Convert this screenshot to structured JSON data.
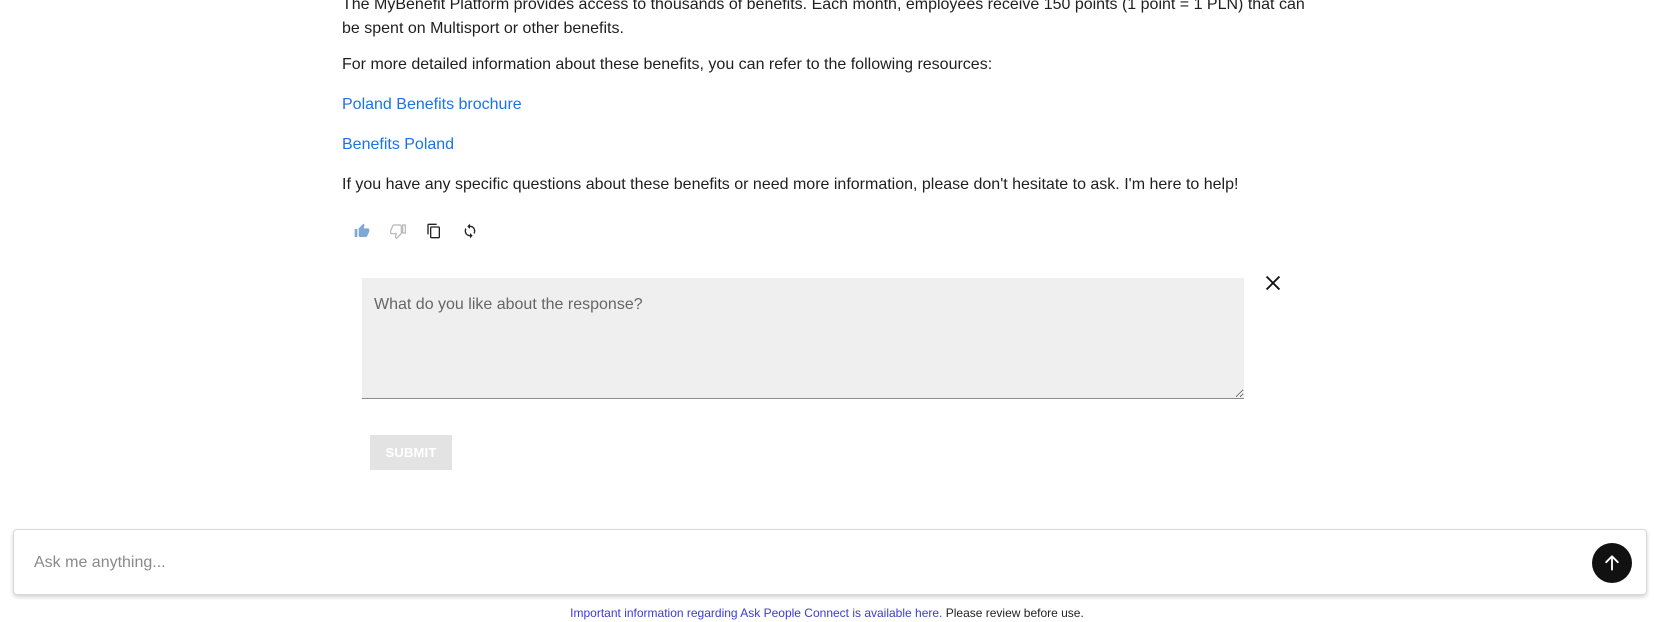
{
  "message": {
    "paragraph_1": "The MyBenefit Platform provides access to thousands of benefits. Each month, employees receive 150 points (1 point = 1 PLN) that can be spent on Multisport or other benefits.",
    "paragraph_2": "For more detailed information about these benefits, you can refer to the following resources:",
    "link_1": "Poland Benefits brochure",
    "link_2": "Benefits Poland",
    "paragraph_3": "If you have any specific questions about these benefits or need more information, please don't hesitate to ask. I'm here to help!"
  },
  "actions": {
    "icons": [
      "thumbs-up-icon",
      "thumbs-down-icon",
      "copy-icon",
      "regenerate-icon"
    ],
    "accent": "#7fa8d6"
  },
  "feedback": {
    "placeholder": "What do you like about the response?",
    "submit_label": "SUBMIT"
  },
  "chat": {
    "placeholder": "Ask me anything..."
  },
  "footer": {
    "link_text": "Important information regarding Ask People Connect is available here.",
    "note": "Please review before use."
  }
}
